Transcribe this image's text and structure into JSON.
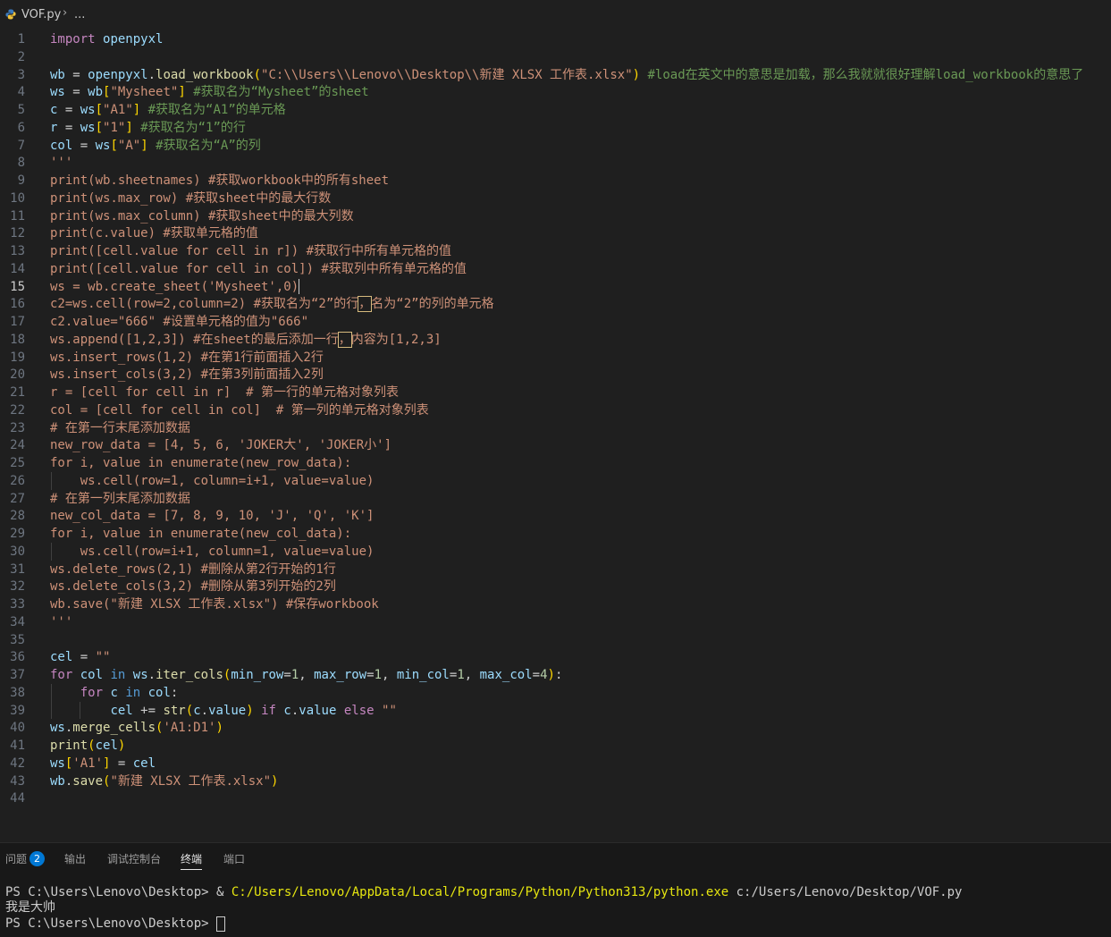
{
  "breadcrumb": {
    "file": "VOF.py",
    "more": "..."
  },
  "editor": {
    "current_line": 15,
    "lines": [
      [
        [
          "k",
          "import"
        ],
        [
          "t",
          " "
        ],
        [
          "v",
          "openpyxl"
        ]
      ],
      [],
      [
        [
          "v",
          "wb"
        ],
        [
          "t",
          " = "
        ],
        [
          "v",
          "openpyxl"
        ],
        [
          "t",
          "."
        ],
        [
          "f",
          "load_workbook"
        ],
        [
          "br",
          "("
        ],
        [
          "s",
          "\"C:\\\\Users\\\\Lenovo\\\\Desktop\\\\新建 XLSX 工作表.xlsx\""
        ],
        [
          "br",
          ")"
        ],
        [
          "t",
          " "
        ],
        [
          "c",
          "#load在英文中的意思是加载，那么我就就很好理解load_workbook的意思了"
        ]
      ],
      [
        [
          "v",
          "ws"
        ],
        [
          "t",
          " = "
        ],
        [
          "v",
          "wb"
        ],
        [
          "br",
          "["
        ],
        [
          "s",
          "\"Mysheet\""
        ],
        [
          "br",
          "]"
        ],
        [
          "t",
          " "
        ],
        [
          "c",
          "#获取名为“Mysheet”的sheet"
        ]
      ],
      [
        [
          "v",
          "c"
        ],
        [
          "t",
          " = "
        ],
        [
          "v",
          "ws"
        ],
        [
          "br",
          "["
        ],
        [
          "s",
          "\"A1\""
        ],
        [
          "br",
          "]"
        ],
        [
          "t",
          " "
        ],
        [
          "c",
          "#获取名为“A1”的单元格"
        ]
      ],
      [
        [
          "v",
          "r"
        ],
        [
          "t",
          " = "
        ],
        [
          "v",
          "ws"
        ],
        [
          "br",
          "["
        ],
        [
          "s",
          "\"1\""
        ],
        [
          "br",
          "]"
        ],
        [
          "t",
          " "
        ],
        [
          "c",
          "#获取名为“1”的行"
        ]
      ],
      [
        [
          "v",
          "col"
        ],
        [
          "t",
          " = "
        ],
        [
          "v",
          "ws"
        ],
        [
          "br",
          "["
        ],
        [
          "s",
          "\"A\""
        ],
        [
          "br",
          "]"
        ],
        [
          "t",
          " "
        ],
        [
          "c",
          "#获取名为“A”的列"
        ]
      ],
      [
        [
          "s",
          "'''"
        ]
      ],
      [
        [
          "s",
          "print(wb.sheetnames) #获取workbook中的所有sheet"
        ]
      ],
      [
        [
          "s",
          "print(ws.max_row) #获取sheet中的最大行数"
        ]
      ],
      [
        [
          "s",
          "print(ws.max_column) #获取sheet中的最大列数"
        ]
      ],
      [
        [
          "s",
          "print(c.value) #获取单元格的值"
        ]
      ],
      [
        [
          "s",
          "print([cell.value for cell in r]) #获取行中所有单元格的值"
        ]
      ],
      [
        [
          "s",
          "print([cell.value for cell in col]) #获取列中所有单元格的值"
        ]
      ],
      [
        [
          "s",
          "ws = wb.create_sheet('Mysheet',0)"
        ],
        [
          "cursor",
          ""
        ]
      ],
      [
        [
          "s",
          "c2=ws.cell(row=2,column=2) #获取名为“2”的行"
        ],
        [
          "sw",
          "，"
        ],
        [
          "s",
          "名为“2”的列的单元格"
        ]
      ],
      [
        [
          "s",
          "c2.value=\"666\" #设置单元格的值为\"666\""
        ]
      ],
      [
        [
          "s",
          "ws.append([1,2,3]) #在sheet的最后添加一行"
        ],
        [
          "sw",
          "，"
        ],
        [
          "s",
          "内容为[1,2,3]"
        ]
      ],
      [
        [
          "s",
          "ws.insert_rows(1,2) #在第1行前面插入2行"
        ]
      ],
      [
        [
          "s",
          "ws.insert_cols(3,2) #在第3列前面插入2列"
        ]
      ],
      [
        [
          "s",
          "r = [cell for cell in r]  # 第一行的单元格对象列表"
        ]
      ],
      [
        [
          "s",
          "col = [cell for cell in col]  # 第一列的单元格对象列表"
        ]
      ],
      [
        [
          "s",
          "# 在第一行末尾添加数据"
        ]
      ],
      [
        [
          "s",
          "new_row_data = [4, 5, 6, 'JOKER大', 'JOKER小']"
        ]
      ],
      [
        [
          "s",
          "for i, value in enumerate(new_row_data):"
        ]
      ],
      [
        [
          "s",
          "    ws.cell(row=1, column=i+1, value=value)"
        ]
      ],
      [
        [
          "s",
          "# 在第一列末尾添加数据"
        ]
      ],
      [
        [
          "s",
          "new_col_data = [7, 8, 9, 10, 'J', 'Q', 'K']"
        ]
      ],
      [
        [
          "s",
          "for i, value in enumerate(new_col_data):"
        ]
      ],
      [
        [
          "s",
          "    ws.cell(row=i+1, column=1, value=value)"
        ]
      ],
      [
        [
          "s",
          "ws.delete_rows(2,1) #删除从第2行开始的1行"
        ]
      ],
      [
        [
          "s",
          "ws.delete_cols(3,2) #删除从第3列开始的2列"
        ]
      ],
      [
        [
          "s",
          "wb.save(\"新建 XLSX 工作表.xlsx\") #保存workbook"
        ]
      ],
      [
        [
          "s",
          "'''"
        ]
      ],
      [],
      [
        [
          "v",
          "cel"
        ],
        [
          "t",
          " = "
        ],
        [
          "s",
          "\"\""
        ]
      ],
      [
        [
          "k",
          "for"
        ],
        [
          "t",
          " "
        ],
        [
          "v",
          "col"
        ],
        [
          "t",
          " "
        ],
        [
          "kb",
          "in"
        ],
        [
          "t",
          " "
        ],
        [
          "v",
          "ws"
        ],
        [
          "t",
          "."
        ],
        [
          "f",
          "iter_cols"
        ],
        [
          "br",
          "("
        ],
        [
          "v",
          "min_row"
        ],
        [
          "t",
          "="
        ],
        [
          "n",
          "1"
        ],
        [
          "t",
          ", "
        ],
        [
          "v",
          "max_row"
        ],
        [
          "t",
          "="
        ],
        [
          "n",
          "1"
        ],
        [
          "t",
          ", "
        ],
        [
          "v",
          "min_col"
        ],
        [
          "t",
          "="
        ],
        [
          "n",
          "1"
        ],
        [
          "t",
          ", "
        ],
        [
          "v",
          "max_col"
        ],
        [
          "t",
          "="
        ],
        [
          "n",
          "4"
        ],
        [
          "br",
          ")"
        ],
        [
          "t",
          ":"
        ]
      ],
      [
        [
          "t",
          "    "
        ],
        [
          "k",
          "for"
        ],
        [
          "t",
          " "
        ],
        [
          "v",
          "c"
        ],
        [
          "t",
          " "
        ],
        [
          "kb",
          "in"
        ],
        [
          "t",
          " "
        ],
        [
          "v",
          "col"
        ],
        [
          "t",
          ":"
        ]
      ],
      [
        [
          "t",
          "        "
        ],
        [
          "v",
          "cel"
        ],
        [
          "t",
          " += "
        ],
        [
          "f",
          "str"
        ],
        [
          "br",
          "("
        ],
        [
          "v",
          "c"
        ],
        [
          "t",
          "."
        ],
        [
          "v",
          "value"
        ],
        [
          "br",
          ")"
        ],
        [
          "t",
          " "
        ],
        [
          "k",
          "if"
        ],
        [
          "t",
          " "
        ],
        [
          "v",
          "c"
        ],
        [
          "t",
          "."
        ],
        [
          "v",
          "value"
        ],
        [
          "t",
          " "
        ],
        [
          "k",
          "else"
        ],
        [
          "t",
          " "
        ],
        [
          "s",
          "\"\""
        ]
      ],
      [
        [
          "v",
          "ws"
        ],
        [
          "t",
          "."
        ],
        [
          "f",
          "merge_cells"
        ],
        [
          "br",
          "("
        ],
        [
          "s",
          "'A1:D1'"
        ],
        [
          "br",
          ")"
        ]
      ],
      [
        [
          "f",
          "print"
        ],
        [
          "br",
          "("
        ],
        [
          "v",
          "cel"
        ],
        [
          "br",
          ")"
        ]
      ],
      [
        [
          "v",
          "ws"
        ],
        [
          "br",
          "["
        ],
        [
          "s",
          "'A1'"
        ],
        [
          "br",
          "]"
        ],
        [
          "t",
          " = "
        ],
        [
          "v",
          "cel"
        ]
      ],
      [
        [
          "v",
          "wb"
        ],
        [
          "t",
          "."
        ],
        [
          "f",
          "save"
        ],
        [
          "br",
          "("
        ],
        [
          "s",
          "\"新建 XLSX 工作表.xlsx\""
        ],
        [
          "br",
          ")"
        ]
      ],
      []
    ]
  },
  "panel": {
    "tabs": [
      {
        "label": "问题",
        "name": "tab-problems",
        "badge": "2"
      },
      {
        "label": "输出",
        "name": "tab-output"
      },
      {
        "label": "调试控制台",
        "name": "tab-debug-console"
      },
      {
        "label": "终端",
        "name": "tab-terminal",
        "active": true
      },
      {
        "label": "端口",
        "name": "tab-ports"
      }
    ],
    "terminal": {
      "line1_prompt": "PS C:\\Users\\Lenovo\\Desktop> ",
      "line1_amp": "& ",
      "line1_exe": "C:/Users/Lenovo/AppData/Local/Programs/Python/Python313/python.exe",
      "line1_arg": " c:/Users/Lenovo/Desktop/VOF.py",
      "line2": "我是大帅",
      "line3_prompt": "PS C:\\Users\\Lenovo\\Desktop> "
    }
  },
  "colors": {
    "background": "#1f1f1f",
    "panel": "#181818",
    "accent": "#0078d4",
    "keyword": "#c586c0",
    "variable": "#9cdcfe",
    "function": "#dcdcaa",
    "string": "#ce9178",
    "number": "#b5cea8",
    "comment": "#6a9955"
  }
}
